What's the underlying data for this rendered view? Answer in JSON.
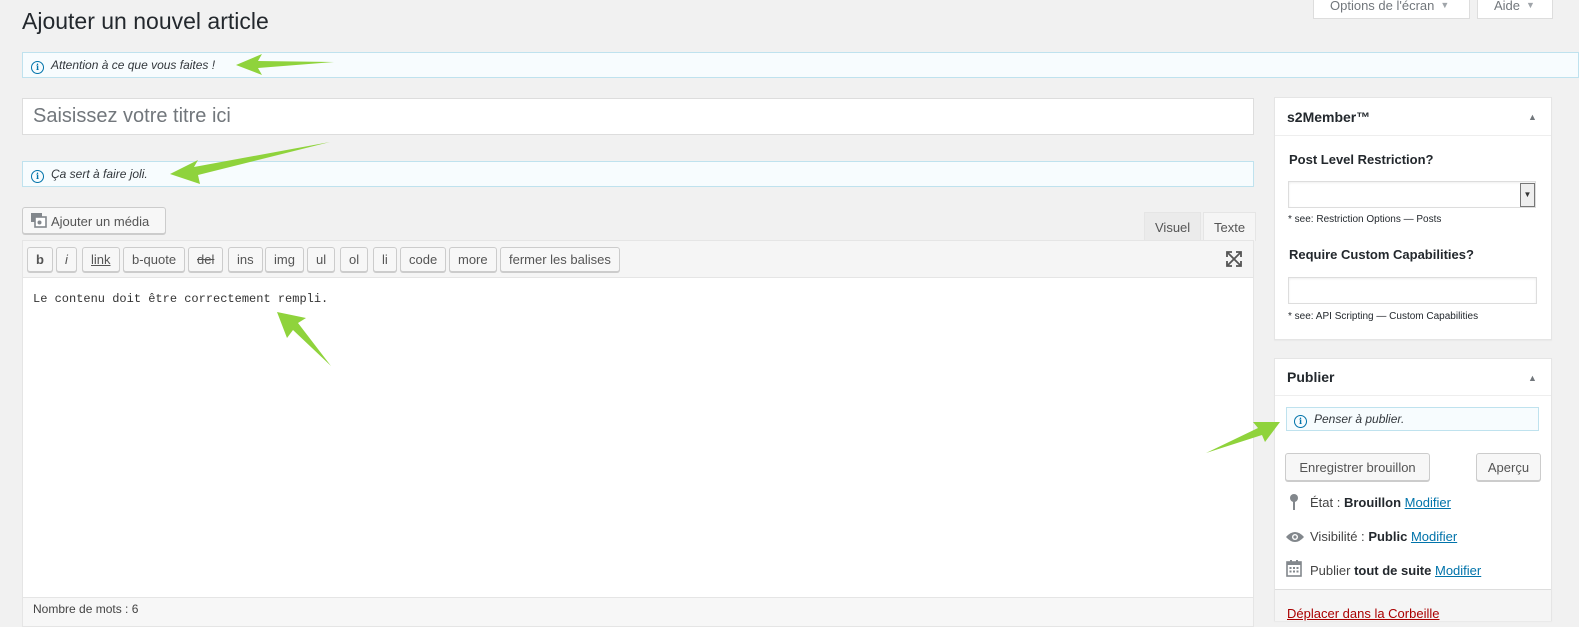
{
  "header": {
    "title": "Ajouter un nouvel article",
    "screen_options": "Options de l'écran",
    "help": "Aide"
  },
  "notices": {
    "top": "Attention à ce que vous faites !",
    "title": "Ça sert à faire joli.",
    "publish": "Penser à publier."
  },
  "title_field": {
    "placeholder": "Saisissez votre titre ici",
    "value": ""
  },
  "media": {
    "button": "Ajouter un média"
  },
  "editor": {
    "tabs": [
      "Visuel",
      "Texte"
    ],
    "active_tab": "Texte",
    "quicktags": [
      "b",
      "i",
      "link",
      "b-quote",
      "del",
      "ins",
      "img",
      "ul",
      "ol",
      "li",
      "code",
      "more",
      "fermer les balises"
    ],
    "content": "Le contenu doit être correctement rempli.",
    "word_count": "Nombre de mots : 6"
  },
  "s2member": {
    "title": "s2Member™",
    "level_label": "Post Level Restriction?",
    "level_value": "",
    "level_hint": "* see: Restriction Options — Posts",
    "caps_label": "Require Custom Capabilities?",
    "caps_value": "",
    "caps_hint": "* see: API Scripting — Custom Capabilities"
  },
  "publish": {
    "title": "Publier",
    "save_draft": "Enregistrer brouillon",
    "preview": "Aperçu",
    "status_label": "État :",
    "status_value": "Brouillon",
    "visibility_label": "Visibilité :",
    "visibility_value": "Public",
    "schedule_label": "Publier",
    "schedule_value": "tout de suite",
    "edit_link": "Modifier",
    "trash": "Déplacer dans la Corbeille"
  },
  "colors": {
    "link": "#0073aa",
    "trash": "#a00000",
    "annotation_arrow": "#8fd33c"
  },
  "icons": [
    "info-icon",
    "media-icon",
    "fullscreen-icon",
    "pin-icon",
    "eye-icon",
    "calendar-icon",
    "triangle-up-icon",
    "chevron-down-icon"
  ]
}
